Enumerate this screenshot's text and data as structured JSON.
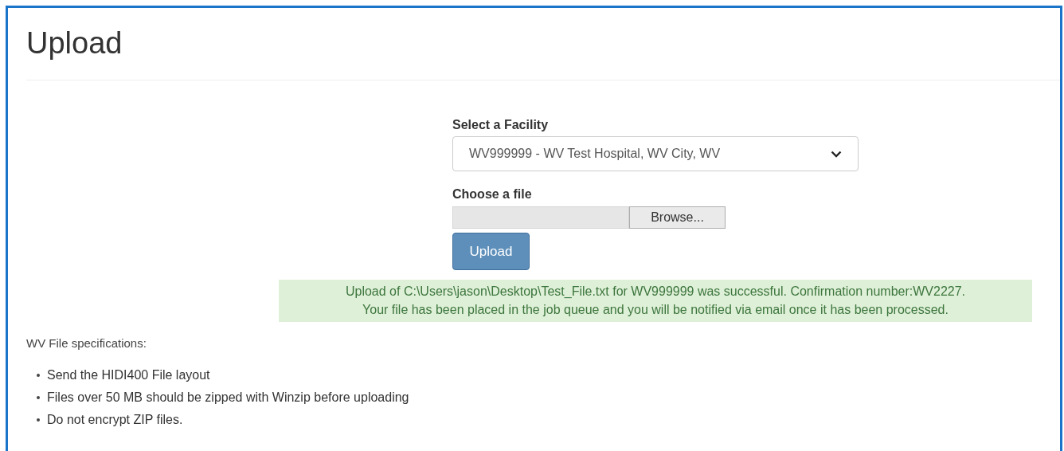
{
  "page": {
    "title": "Upload"
  },
  "form": {
    "facility_label": "Select a Facility",
    "facility_value": "WV999999 - WV Test Hospital, WV City, WV",
    "file_label": "Choose a file",
    "browse_button": "Browse...",
    "upload_button": "Upload"
  },
  "alert": {
    "kind": "success",
    "lines": [
      "Upload of C:\\Users\\jason\\Desktop\\Test_File.txt for WV999999 was successful. Confirmation number:WV2227.",
      "Your file has been placed in the job queue and you will be notified via email once it has been processed."
    ]
  },
  "specifications": {
    "heading": "WV File specifications:",
    "items": [
      "Send the HIDI400 File layout",
      "Files over 50 MB should be zipped with Winzip before uploading",
      "Do not encrypt ZIP files."
    ]
  }
}
